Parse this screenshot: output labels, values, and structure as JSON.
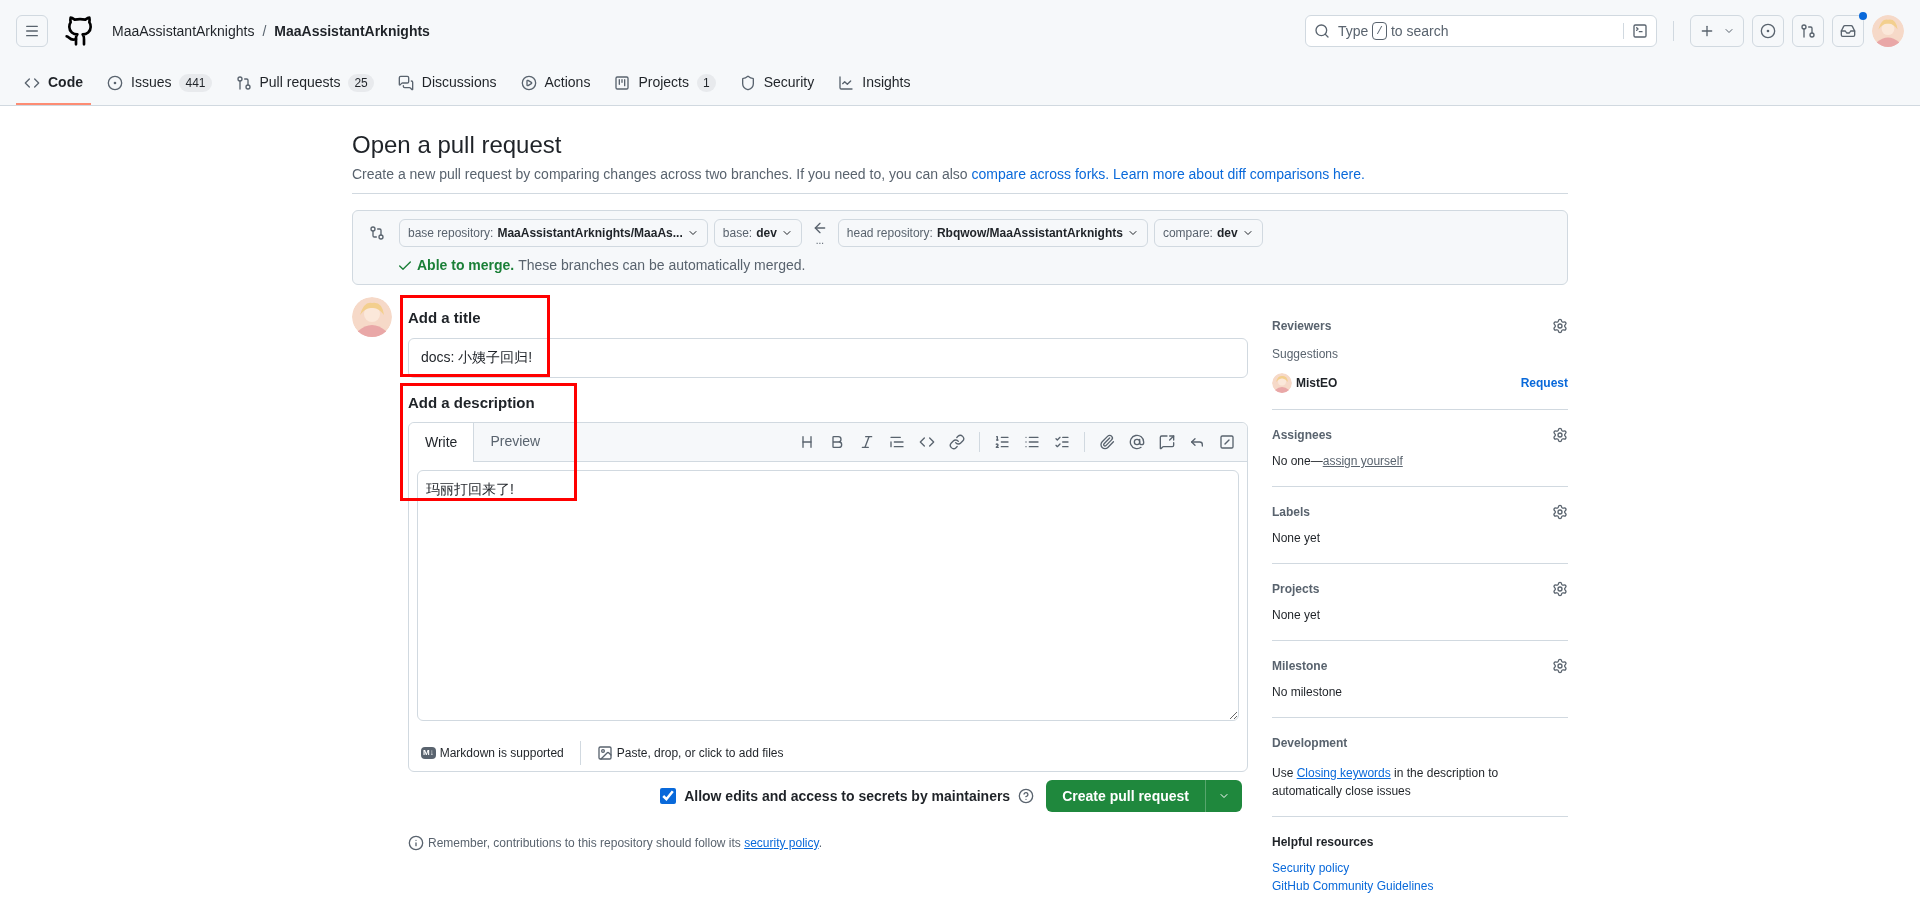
{
  "header": {
    "owner": "MaaAssistantArknights",
    "separator": "/",
    "repo": "MaaAssistantArknights",
    "search": {
      "prefix": "Type",
      "key": "/",
      "suffix": "to search"
    },
    "inbox_unread": true
  },
  "nav_tabs": [
    {
      "label": "Code",
      "selected": true
    },
    {
      "label": "Issues",
      "count": "441",
      "selected": false
    },
    {
      "label": "Pull requests",
      "count": "25",
      "selected": false
    },
    {
      "label": "Discussions",
      "selected": false
    },
    {
      "label": "Actions",
      "selected": false
    },
    {
      "label": "Projects",
      "count": "1",
      "selected": false
    },
    {
      "label": "Security",
      "selected": false
    },
    {
      "label": "Insights",
      "selected": false
    }
  ],
  "page": {
    "title": "Open a pull request",
    "subtitle": "Create a new pull request by comparing changes across two branches. If you need to, you can also",
    "links": [
      "compare across forks.",
      "Learn more about diff comparisons here."
    ]
  },
  "compare": {
    "selectors": [
      {
        "label": "base repository:",
        "value": "MaaAssistantArknights/MaaAs..."
      },
      {
        "label": "base:",
        "value": "dev"
      },
      {
        "label": "head repository:",
        "value": "Rbqwow/MaaAssistantArknights"
      },
      {
        "label": "compare:",
        "value": "dev"
      }
    ],
    "arrow_dots": "...",
    "merge_title": "Able to merge.",
    "merge_text": "These branches can be automatically merged.",
    "mergeable": true
  },
  "form": {
    "title_label": "Add a title",
    "title_value": "docs: 小姨子回归!",
    "title_highlighted": true,
    "description_label": "Add a description",
    "description_highlighted": true,
    "editor_tabs": [
      {
        "label": "Write",
        "selected": true
      },
      {
        "label": "Preview",
        "selected": false
      }
    ],
    "body": "玛丽打回来了!",
    "markdown_note": "Markdown is supported",
    "markdown_badge": "M↓",
    "attach_note": "Paste, drop, or click to add files",
    "allow_edits": {
      "label": "Allow edits and access to secrets by maintainers",
      "checked": true
    },
    "submit": "Create pull request",
    "remember": "Remember, contributions to this repository should follow its",
    "remember_link": "security policy",
    "remember_end": "."
  },
  "sidebar": {
    "reviewers": {
      "title": "Reviewers",
      "suggestions": "Suggestions",
      "user": "MistEO",
      "action": "Request"
    },
    "sections": [
      {
        "title": "Assignees",
        "kind": "assign",
        "prefix": "No one—",
        "link": "assign yourself"
      },
      {
        "title": "Labels",
        "kind": "text",
        "text": "None yet"
      },
      {
        "title": "Projects",
        "kind": "text",
        "text": "None yet"
      },
      {
        "title": "Milestone",
        "kind": "text",
        "text": "No milestone"
      }
    ],
    "development": {
      "title": "Development",
      "prefix": "Use",
      "link": "Closing keywords",
      "suffix": "in the description to automatically close issues"
    },
    "resources": {
      "title": "Helpful resources",
      "links": [
        "Security policy",
        "GitHub Community Guidelines"
      ]
    }
  }
}
